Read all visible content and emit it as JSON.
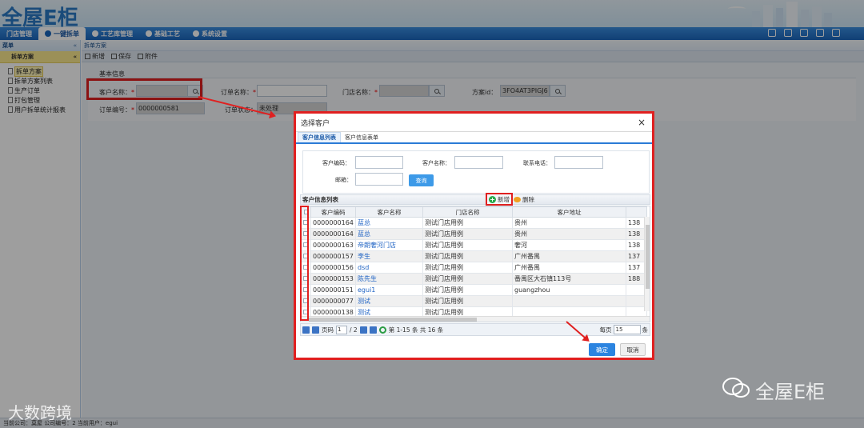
{
  "app": {
    "logo": "全屋E柜"
  },
  "topnav": {
    "items": [
      "门店管理",
      "一键拆单",
      "工艺库管理",
      "基础工艺",
      "系统设置"
    ],
    "active_index": 1
  },
  "sidebar": {
    "title": "菜单",
    "collapse_glyph": "«",
    "group": "拆单方案",
    "group_glyph": "«",
    "items": [
      "拆单方案",
      "拆单方案列表",
      "生产订单",
      "打包管理",
      "用户拆单统计报表"
    ]
  },
  "content": {
    "breadcrumb": "拆单方案",
    "toolbar": {
      "add": "新增",
      "save": "保存",
      "attach": "附件"
    },
    "section_title": "基本信息",
    "form": {
      "customer_label": "客户名称：",
      "order_name_label": "订单名称：",
      "store_label": "门店名称：",
      "scheme_id_label": "方案id：",
      "scheme_id_value": "3FO4AT3PIGJ6",
      "order_no_label": "订单编号：",
      "order_no_value": "0000000581",
      "order_status_label": "订单状态：",
      "order_status_value": "未处理"
    }
  },
  "status_bar": "当前公司：莫屋   公司编号：2   当前用户：egui",
  "dialog": {
    "title": "选择客户",
    "close": "×",
    "tabs": [
      "客户信息列表",
      "客户信息表单"
    ],
    "search": {
      "code_label": "客户编码：",
      "name_label": "客户名称：",
      "phone_label": "联系电话：",
      "email_label": "邮箱：",
      "query": "查询"
    },
    "list_title": "客户信息列表",
    "add": "新增",
    "delete": "删除",
    "columns": [
      "客户编码",
      "客户名称",
      "门店名称",
      "客户地址",
      ""
    ],
    "rows": [
      [
        "0000000164",
        "蓝总",
        "测试门店用例",
        "贵州",
        "138"
      ],
      [
        "0000000164",
        "蓝总",
        "测试门店用例",
        "贵州",
        "138"
      ],
      [
        "0000000163",
        "帝朗奢河门店",
        "测试门店用例",
        "奢河",
        "138"
      ],
      [
        "0000000157",
        "李生",
        "测试门店用例",
        "广州番禺",
        "137"
      ],
      [
        "0000000156",
        "dsd",
        "测试门店用例",
        "广州番禺",
        "137"
      ],
      [
        "0000000153",
        "陈先生",
        "测试门店用例",
        "番禺区大石镇113号",
        "188"
      ],
      [
        "0000000151",
        "egui1",
        "测试门店用例",
        "guangzhou",
        ""
      ],
      [
        "0000000077",
        "测试",
        "测试门店用例",
        "",
        ""
      ],
      [
        "0000000138",
        "测试",
        "测试门店用例",
        "",
        ""
      ]
    ],
    "pager": {
      "page_label": "页码",
      "page": "1",
      "total_pages": "/ 2",
      "range": "第 1-15 条  共 16 条",
      "per_page_label": "每页",
      "per_page": "15",
      "unit": "条"
    },
    "ok": "确定",
    "cancel": "取消"
  },
  "watermarks": {
    "left": "大数跨境",
    "right": "全屋E柜"
  },
  "colors": {
    "accent": "#2b84e0",
    "highlight": "#e02020",
    "nav": "#1b66bd"
  }
}
